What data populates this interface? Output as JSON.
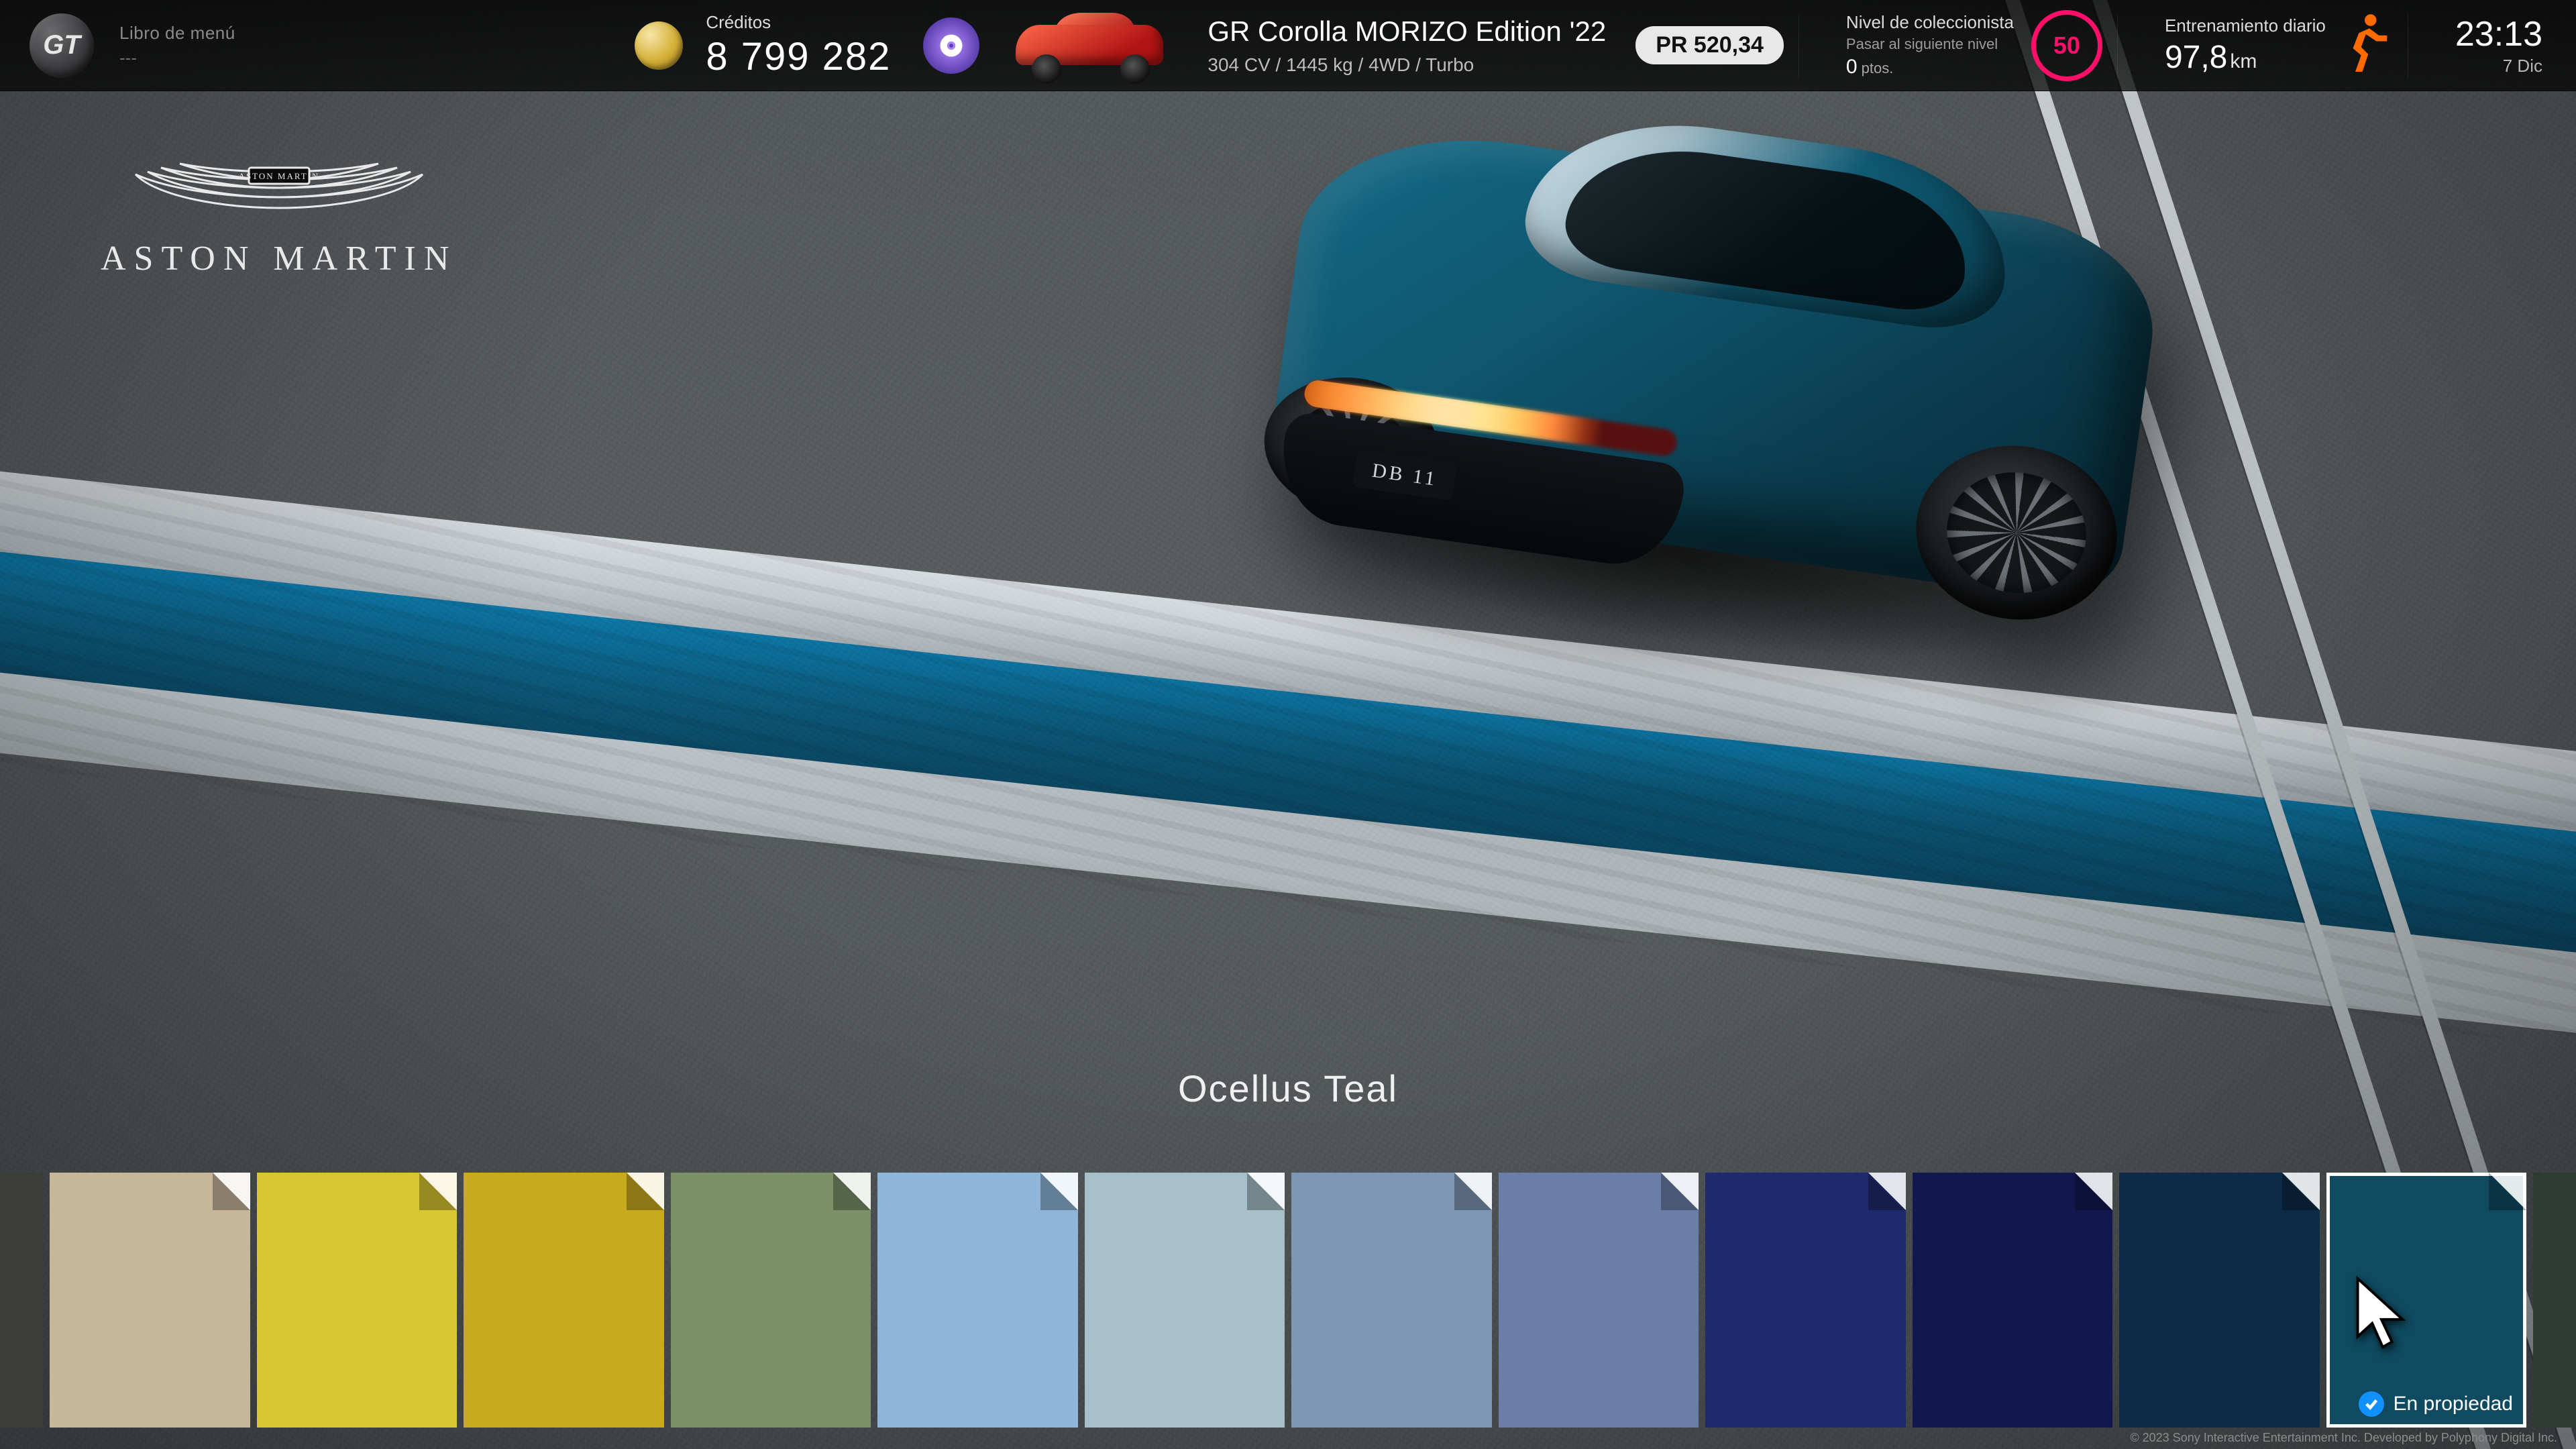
{
  "topbar": {
    "menu_book_label": "Libro de menú",
    "menu_book_value": "---",
    "credits_label": "Créditos",
    "credits_value": "8 799 282",
    "garage_car_name": "GR Corolla MORIZO Edition '22",
    "garage_car_spec": "304 CV / 1445 kg / 4WD / Turbo",
    "pp_label": "PR 520,34",
    "collector_label": "Nivel de coleccionista",
    "collector_sub": "Pasar al siguiente nivel",
    "collector_pts_value": "0",
    "collector_pts_unit": "ptos.",
    "collector_level": "50",
    "daily_label": "Entrenamiento diario",
    "daily_value": "97,8",
    "daily_unit": "km",
    "clock_time": "23:13",
    "clock_date": "7 Dic"
  },
  "brand": {
    "name": "ASTON MARTIN"
  },
  "preview": {
    "plate": "DB 11"
  },
  "selected_color_name": "Ocellus Teal",
  "owned_label": "En propiedad",
  "swatches": [
    {
      "hex": "#3c3c3b",
      "edge": "l"
    },
    {
      "hex": "#c6b79a"
    },
    {
      "hex": "#d7c531"
    },
    {
      "hex": "#c9aa1f"
    },
    {
      "hex": "#7c9069"
    },
    {
      "hex": "#8fb6d8"
    },
    {
      "hex": "#a7bfc9"
    },
    {
      "hex": "#7e97b4"
    },
    {
      "hex": "#6b7ea7"
    },
    {
      "hex": "#1e2a6d"
    },
    {
      "hex": "#11184e"
    },
    {
      "hex": "#0d2a46"
    },
    {
      "hex": "#0f4a60",
      "selected": true,
      "owned": true
    },
    {
      "hex": "#2f3a33",
      "edge": "r"
    }
  ],
  "copyright": "© 2023 Sony Interactive Entertainment Inc. Developed by Polyphony Digital Inc."
}
